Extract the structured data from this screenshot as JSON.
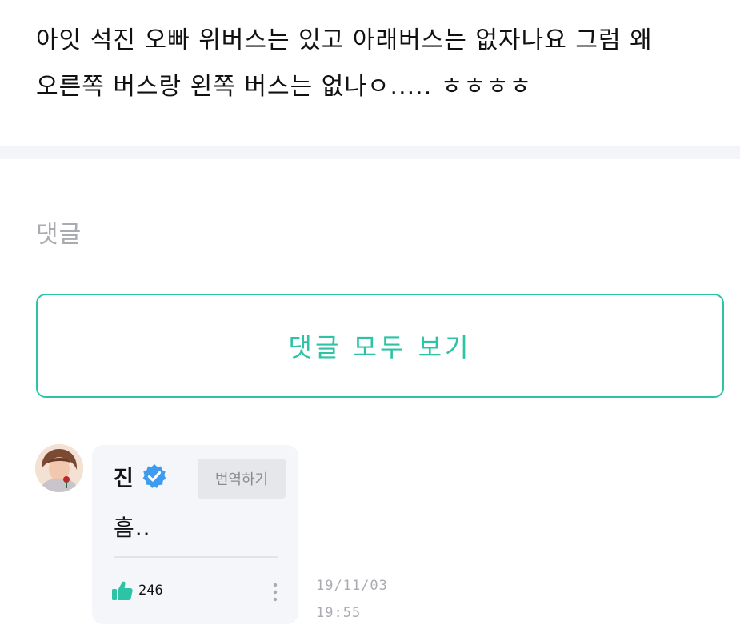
{
  "post": {
    "body": "아잇 석진 오빠 위버스는 있고 아래버스는 없자나요 그럼 왜\n오른쪽 버스랑 왼쪽 버스는 없나ㅇ..... ㅎㅎㅎㅎ"
  },
  "comments": {
    "heading": "댓글",
    "view_all_label": "댓글 모두 보기",
    "items": [
      {
        "author": "진",
        "verified": true,
        "translate_label": "번역하기",
        "text": "흠..",
        "likes": "246",
        "date": "19/11/03",
        "time": "19:55",
        "avatar_icon": "profile-photo"
      }
    ]
  },
  "colors": {
    "accent": "#2dc4a5",
    "verified": "#3d9bf0",
    "muted": "#a9abb1",
    "card_bg": "#f5f6fa"
  },
  "icons": {
    "verified": "verified-badge-icon",
    "like": "thumbs-up-icon",
    "more": "more-vertical-icon"
  }
}
